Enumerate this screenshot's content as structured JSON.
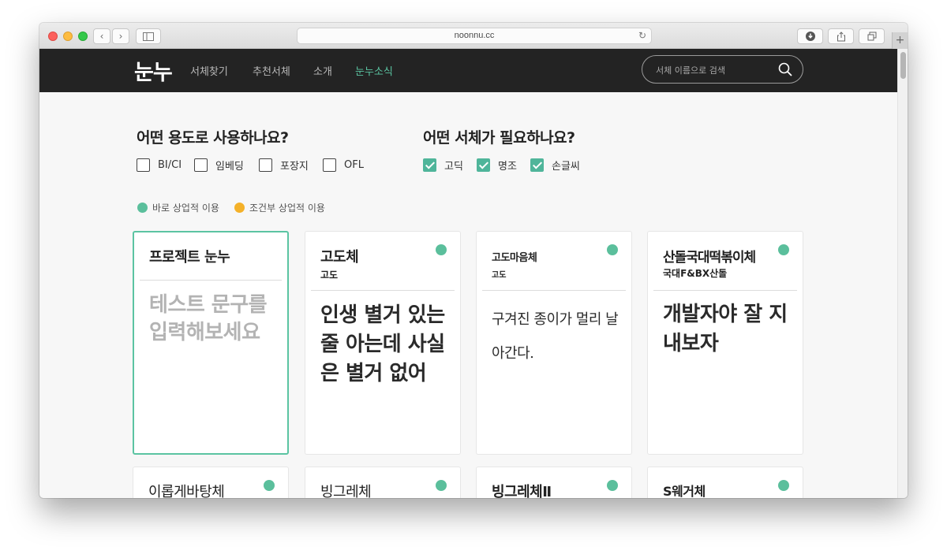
{
  "browser": {
    "url": "noonnu.cc",
    "reload_icon": "↻",
    "back_icon": "‹",
    "forward_icon": "›",
    "new_tab": "+"
  },
  "nav": {
    "logo": "눈누",
    "items": [
      "서체찾기",
      "추천서체",
      "소개",
      "눈누소식"
    ],
    "active_index": 3,
    "search_placeholder": "서체 이름으로 검색"
  },
  "filters": {
    "usage_title": "어떤 용도로 사용하나요?",
    "usage_options": [
      {
        "label": "BI/CI",
        "checked": false
      },
      {
        "label": "임베딩",
        "checked": false
      },
      {
        "label": "포장지",
        "checked": false
      },
      {
        "label": "OFL",
        "checked": false
      }
    ],
    "style_title": "어떤 서체가 필요하나요?",
    "style_options": [
      {
        "label": "고딕",
        "checked": true
      },
      {
        "label": "명조",
        "checked": true
      },
      {
        "label": "손글씨",
        "checked": true
      }
    ]
  },
  "legend": {
    "commercial": "바로 상업적 이용",
    "conditional": "조건부 상업적 이용",
    "commercial_color": "#5bbf9c",
    "conditional_color": "#f4b129"
  },
  "cards": [
    {
      "name": "프로젝트 눈누",
      "maker": "",
      "sample": "테스트 문구를 입력해보세요"
    },
    {
      "name": "고도체",
      "maker": "고도",
      "sample": "인생 별거 있는 줄 아는데 사실은 별거 없어"
    },
    {
      "name": "고도마음체",
      "maker": "고도",
      "sample": "구겨진 종이가 멀리 날아간다."
    },
    {
      "name": "산돌국대떡볶이체",
      "maker": "국대F&BX산돌",
      "sample": "개발자야 잘 지내보자"
    },
    {
      "name": "이롭게바탕체",
      "maker": "",
      "sample": ""
    },
    {
      "name": "빙그레체",
      "maker": "",
      "sample": ""
    },
    {
      "name": "빙그레체Ⅱ",
      "maker": "",
      "sample": ""
    },
    {
      "name": "S웨거체",
      "maker": "",
      "sample": ""
    }
  ]
}
